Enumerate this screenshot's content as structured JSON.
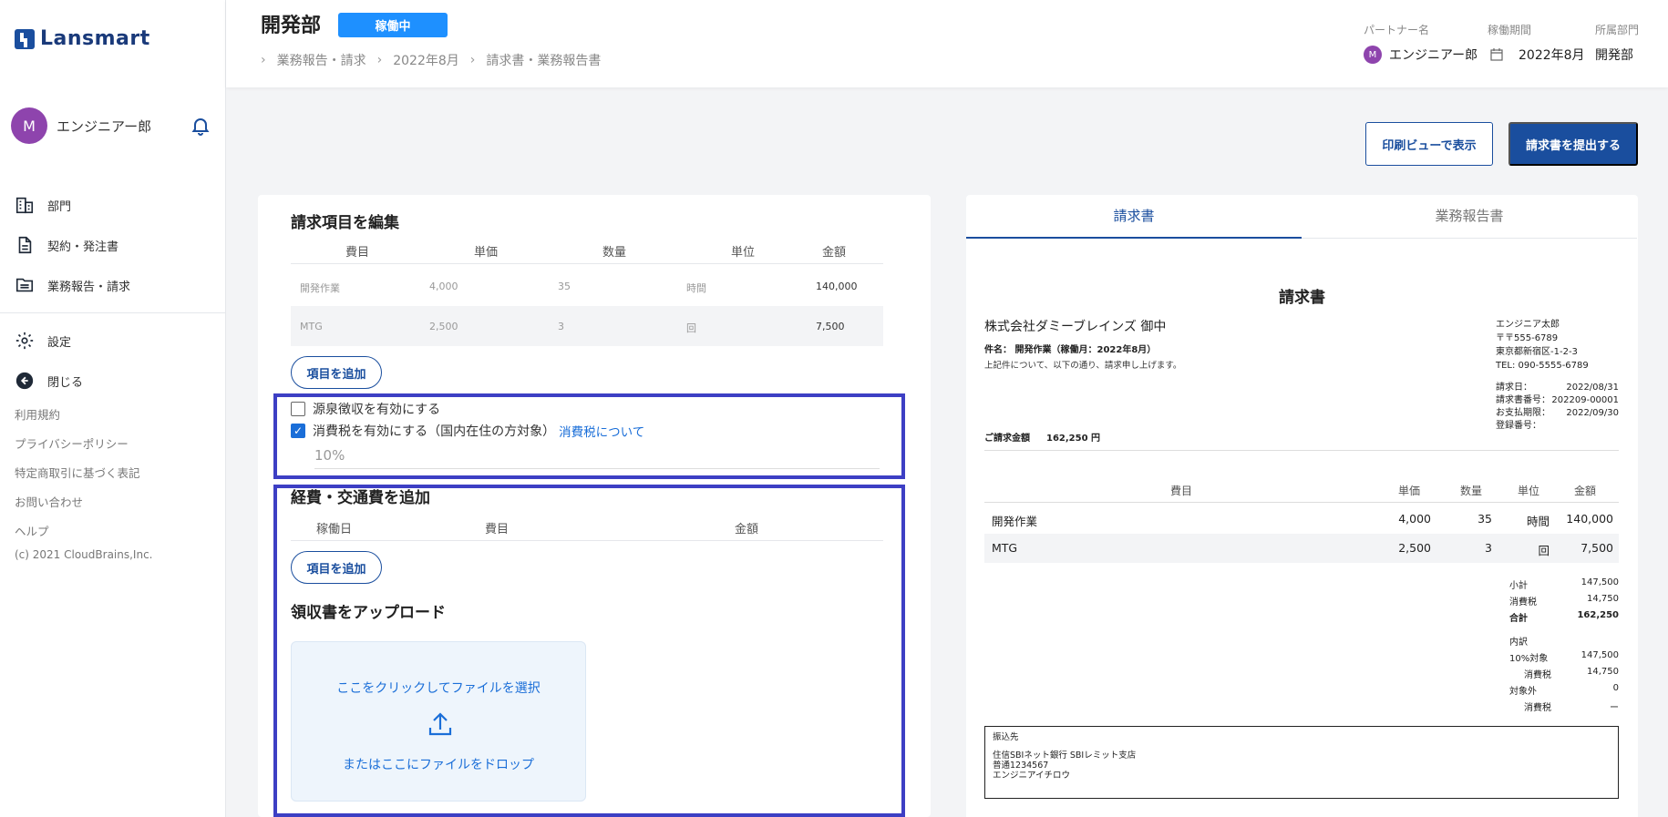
{
  "brand": {
    "name": "Lansmart"
  },
  "user": {
    "initial": "M",
    "name": "エンジニアー郎"
  },
  "nav": {
    "items": [
      {
        "label": "部門",
        "icon": "building-icon"
      },
      {
        "label": "契約・発注書",
        "icon": "document-icon"
      },
      {
        "label": "業務報告・請求",
        "icon": "folder-icon"
      }
    ],
    "settings": "設定",
    "close": "閉じる"
  },
  "footer": {
    "links": [
      "利用規約",
      "プライバシーポリシー",
      "特定商取引に基づく表記",
      "お問い合わせ",
      "ヘルプ"
    ],
    "copyright": "(c) 2021 CloudBrains,Inc."
  },
  "header": {
    "title": "開発部",
    "status": "稼働中",
    "breadcrumb": [
      "業務報告・請求",
      "2022年8月",
      "請求書・業務報告書"
    ],
    "partner_label": "パートナー名",
    "partner_initial": "M",
    "partner_value": "エンジニアー郎",
    "period_label": "稼働期間",
    "period_value": "2022年8月",
    "dept_label": "所属部門",
    "dept_value": "開発部"
  },
  "actions": {
    "print_view": "印刷ビューで表示",
    "submit": "請求書を提出する"
  },
  "edit": {
    "title": "請求項目を編集",
    "columns": [
      "費目",
      "単価",
      "数量",
      "単位",
      "金額"
    ],
    "rows": [
      {
        "item": "開発作業",
        "price": "4,000",
        "qty": "35",
        "unit": "時間",
        "amount": "140,000"
      },
      {
        "item": "MTG",
        "price": "2,500",
        "qty": "3",
        "unit": "回",
        "amount": "7,500"
      }
    ],
    "add_item": "項目を追加",
    "withholding": "源泉徴収を有効にする",
    "tax": "消費税を有効にする（国内在住の方対象）",
    "tax_link": "消費税について",
    "tax_rate": "10%"
  },
  "expenses": {
    "title": "経費・交通費を追加",
    "columns": [
      "稼働日",
      "費目",
      "金額"
    ],
    "add_item": "項目を追加",
    "receipt_title": "領収書をアップロード",
    "upload_click": "ここをクリックしてファイルを選択",
    "upload_drop": "またはここにファイルをドロップ"
  },
  "tabs": {
    "invoice": "請求書",
    "report": "業務報告書"
  },
  "invoice": {
    "title": "請求書",
    "to": "株式会社ダミーブレインズ 御中",
    "subject": "件名： 開発作業（稼働月：2022年8月）",
    "note": "上記件について、以下の通り、請求申し上げます。",
    "issuer": [
      "エンジニア太郎",
      "〒〒555-6789",
      "東京都新宿区-1-2-3",
      "TEL: 090-5555-6789"
    ],
    "info": [
      {
        "k": "請求日：",
        "v": "2022/08/31"
      },
      {
        "k": "請求書番号：",
        "v": "202209-00001"
      },
      {
        "k": "お支払期限：",
        "v": "2022/09/30"
      },
      {
        "k": "登録番号：",
        "v": ""
      }
    ],
    "total_label": "ご請求金額",
    "total_value": "162,250 円",
    "columns": [
      "費目",
      "単価",
      "数量",
      "単位",
      "金額"
    ],
    "rows": [
      {
        "item": "開発作業",
        "price": "4,000",
        "qty": "35",
        "unit": "時間",
        "amount": "140,000"
      },
      {
        "item": "MTG",
        "price": "2,500",
        "qty": "3",
        "unit": "回",
        "amount": "7,500"
      }
    ],
    "summary": [
      {
        "k": "小計",
        "v": "147,500"
      },
      {
        "k": "消費税",
        "v": "14,750"
      },
      {
        "k": "合計",
        "v": "162,250"
      }
    ],
    "breakdown_label": "内訳",
    "breakdown": [
      {
        "k": "10%対象",
        "v": "147,500"
      },
      {
        "k": "消費税",
        "v": "14,750"
      },
      {
        "k": "対象外",
        "v": "0"
      },
      {
        "k": "消費税",
        "v": "ー"
      }
    ],
    "bank_label": "振込先",
    "bank_lines": [
      "住信SBIネット銀行 SBIレミット支店",
      "普通1234567",
      "エンジニアイチロウ"
    ]
  }
}
